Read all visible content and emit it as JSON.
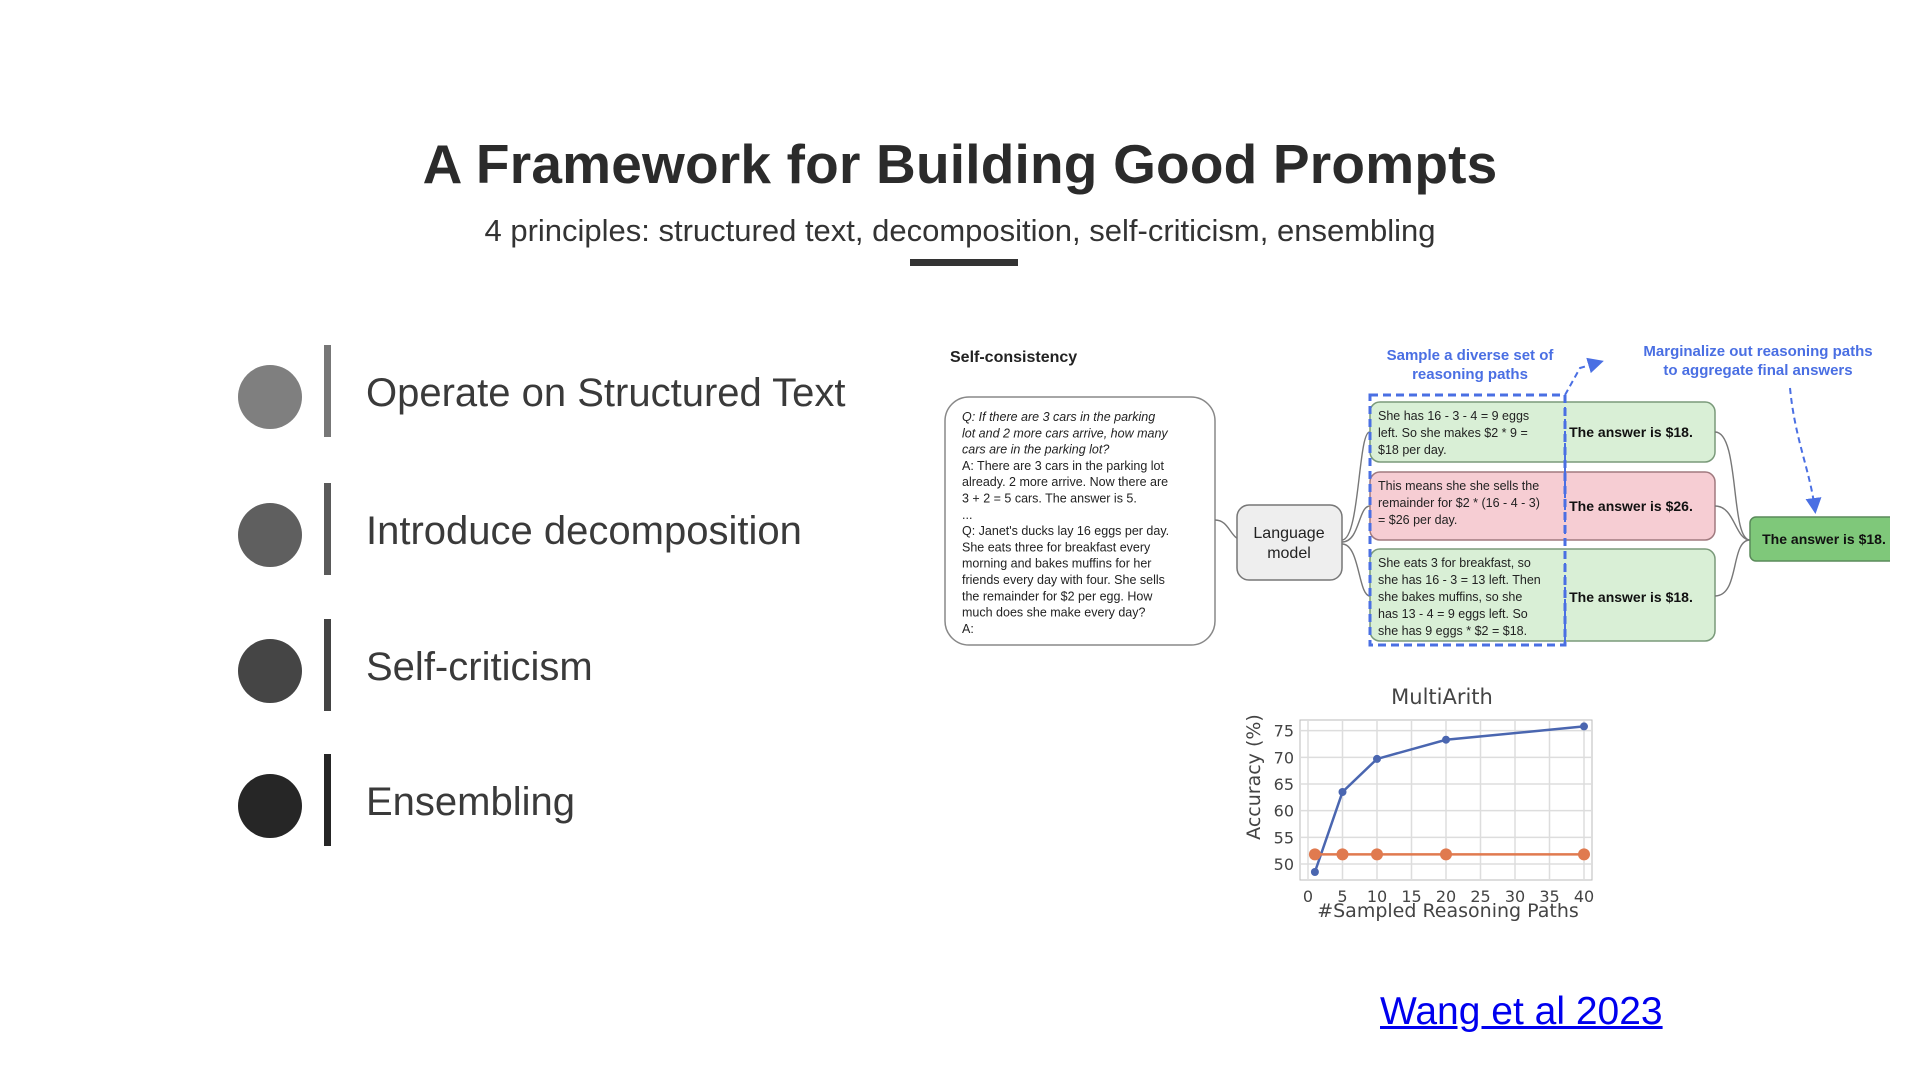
{
  "slide": {
    "title": "A Framework for Building Good Prompts",
    "subtitle": "4 principles: structured text, decomposition, self-criticism, ensembling",
    "citation": "Wang et al 2023"
  },
  "principles": [
    {
      "label": "Operate on Structured Text",
      "dot_color": "#7f7f7f",
      "bar_color": "#777777"
    },
    {
      "label": "Introduce decomposition",
      "dot_color": "#5f5f5f",
      "bar_color": "#5a5a5a"
    },
    {
      "label": "Self-criticism",
      "dot_color": "#454545",
      "bar_color": "#444444"
    },
    {
      "label": "Ensembling",
      "dot_color": "#262626",
      "bar_color": "#262626"
    }
  ],
  "figure": {
    "heading": "Self-consistency",
    "prompt_lines": [
      "Q: If there are 3 cars in the parking",
      "lot and 2 more cars arrive, how many",
      "cars are in the parking lot?",
      "A: There are 3 cars in the parking lot",
      "already. 2 more arrive. Now there are",
      "3 + 2 = 5 cars. The answer is 5.",
      "...",
      "Q: Janet's ducks lay 16 eggs per day.",
      "She eats three for breakfast every",
      "morning and bakes muffins for her",
      "friends every day with four. She sells",
      "the remainder for $2 per egg. How",
      "much does she make every day?",
      "A:"
    ],
    "model_label": [
      "Language",
      "model"
    ],
    "sample_note": [
      "Sample a diverse set of",
      "reasoning paths"
    ],
    "marginalize_note": [
      "Marginalize out reasoning paths",
      "to aggregate final answers"
    ],
    "paths": [
      {
        "lines": [
          "She has 16 - 3 - 4 = 9 eggs",
          "left. So she makes $2 * 9 =",
          "$18 per day."
        ],
        "answer": "The answer is $18.",
        "fill": "#d9efd6",
        "stroke": "#7a9a7a"
      },
      {
        "lines": [
          "This means she she sells the",
          "remainder for $2 * (16 - 4 - 3)",
          "= $26 per day."
        ],
        "answer": "The answer is $26.",
        "fill": "#f6cdd3",
        "stroke": "#a07a7f"
      },
      {
        "lines": [
          "She eats 3 for breakfast, so",
          "she has 16 - 3 = 13 left. Then",
          "she bakes muffins, so she",
          "has 13 - 4 = 9 eggs left. So",
          "she has 9 eggs * $2 = $18."
        ],
        "answer": "The answer is $18.",
        "fill": "#d9efd6",
        "stroke": "#7a9a7a"
      }
    ],
    "final_answer": "The answer is $18.",
    "final_fill": "#7fc87a",
    "accent_blue": "#4a6fe3"
  },
  "chart_data": {
    "type": "line",
    "title": "MultiArith",
    "xlabel": "#Sampled Reasoning Paths",
    "ylabel": "Accuracy (%)",
    "x_ticks": [
      0,
      5,
      10,
      15,
      20,
      25,
      30,
      35,
      40
    ],
    "y_ticks": [
      50,
      55,
      60,
      65,
      70,
      75
    ],
    "xlim": [
      0,
      40
    ],
    "ylim": [
      47,
      77
    ],
    "grid": true,
    "series": [
      {
        "color": "#4a66b0",
        "x": [
          1,
          5,
          10,
          20,
          40
        ],
        "y": [
          48.5,
          63.5,
          69.7,
          73.3,
          75.8
        ]
      },
      {
        "color": "#e07a4f",
        "x": [
          1,
          5,
          10,
          20,
          40
        ],
        "y": [
          51.8,
          51.8,
          51.8,
          51.8,
          51.8
        ]
      }
    ]
  }
}
